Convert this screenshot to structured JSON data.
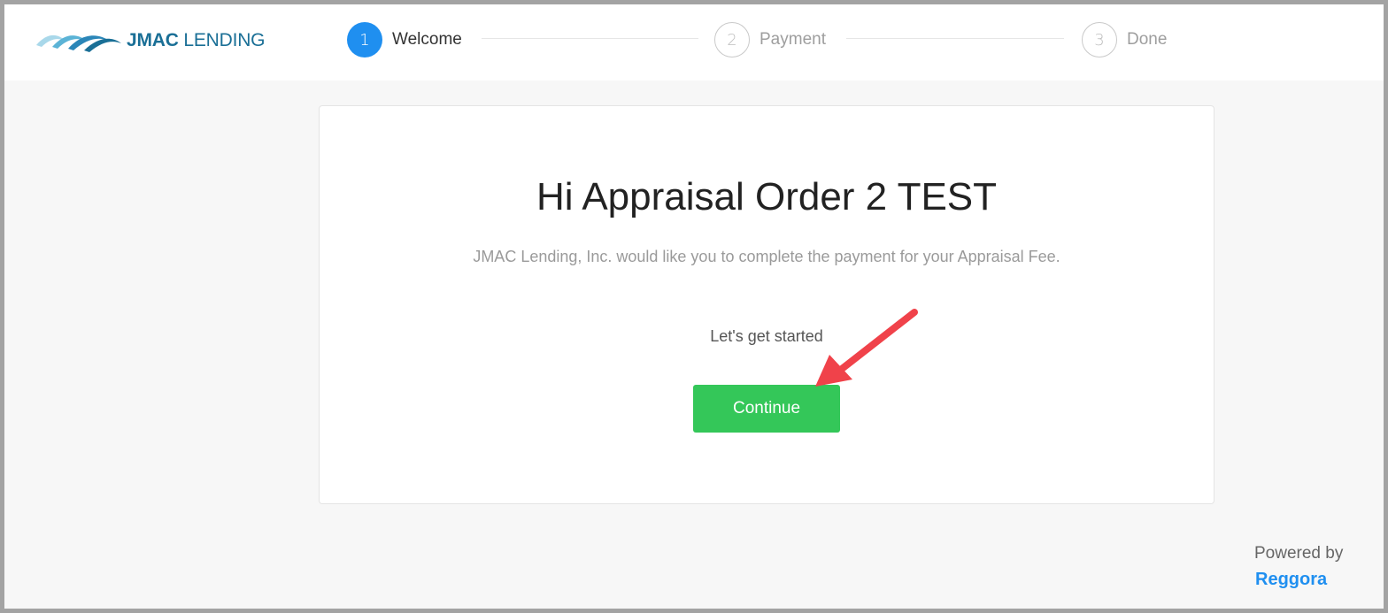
{
  "brand": {
    "logo_bold": "JMAC",
    "logo_light": "LENDING",
    "logo_color": "#1a6f96"
  },
  "steps": [
    {
      "number": "1",
      "label": "Welcome",
      "state": "active"
    },
    {
      "number": "2",
      "label": "Payment",
      "state": "inactive"
    },
    {
      "number": "3",
      "label": "Done",
      "state": "inactive"
    }
  ],
  "card": {
    "title": "Hi Appraisal Order 2 TEST",
    "subtitle": "JMAC Lending, Inc. would like you to complete the payment for your Appraisal Fee.",
    "start_text": "Let's get started",
    "continue_label": "Continue"
  },
  "footer": {
    "powered_label": "Powered by",
    "powered_brand": "Reggora"
  },
  "colors": {
    "accent": "#1f8ff0",
    "button": "#34c759",
    "annotation_arrow": "#f0424a"
  }
}
